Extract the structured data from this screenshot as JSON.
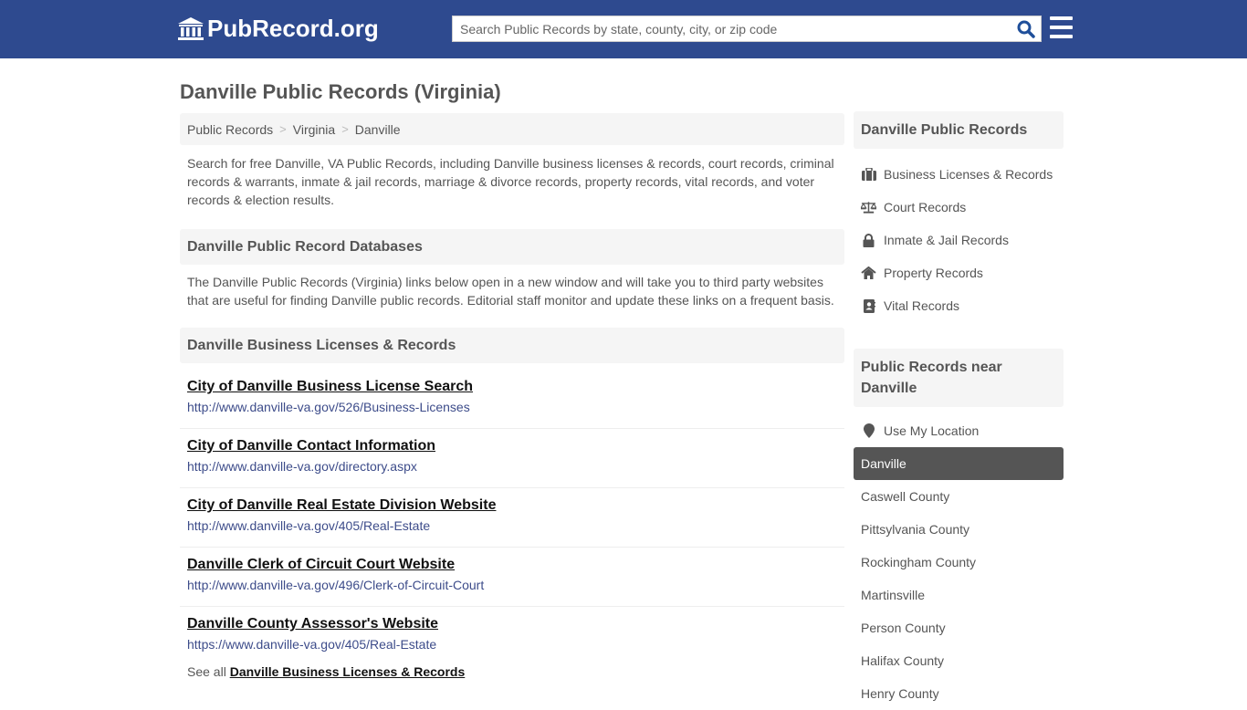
{
  "header": {
    "logo_text": "PubRecord.org",
    "search_placeholder": "Search Public Records by state, county, city, or zip code",
    "search_value": ""
  },
  "page_title": "Danville Public Records (Virginia)",
  "breadcrumb": [
    {
      "label": "Public Records"
    },
    {
      "label": "Virginia"
    },
    {
      "label": "Danville"
    }
  ],
  "intro": "Search for free Danville, VA Public Records, including Danville business licenses & records, court records, criminal records & warrants, inmate & jail records, marriage & divorce records, property records, vital records, and voter records & election results.",
  "databases": {
    "heading": "Danville Public Record Databases",
    "text": "The Danville Public Records (Virginia) links below open in a new window and will take you to third party websites that are useful for finding Danville public records. Editorial staff monitor and update these links on a frequent basis."
  },
  "business": {
    "heading": "Danville Business Licenses & Records",
    "links": [
      {
        "title": "City of Danville Business License Search",
        "url": "http://www.danville-va.gov/526/Business-Licenses"
      },
      {
        "title": "City of Danville Contact Information",
        "url": "http://www.danville-va.gov/directory.aspx"
      },
      {
        "title": "City of Danville Real Estate Division Website",
        "url": "http://www.danville-va.gov/405/Real-Estate"
      },
      {
        "title": "Danville Clerk of Circuit Court Website",
        "url": "http://www.danville-va.gov/496/Clerk-of-Circuit-Court"
      },
      {
        "title": "Danville County Assessor's Website",
        "url": "https://www.danville-va.gov/405/Real-Estate"
      }
    ],
    "see_all_prefix": "See all",
    "see_all_link": "Danville Business Licenses & Records"
  },
  "sidebar": {
    "records_heading": "Danville Public Records",
    "records": [
      {
        "label": "Business Licenses & Records",
        "icon": "briefcase-icon"
      },
      {
        "label": "Court Records",
        "icon": "scale-icon"
      },
      {
        "label": "Inmate & Jail Records",
        "icon": "lock-icon"
      },
      {
        "label": "Property Records",
        "icon": "home-icon"
      },
      {
        "label": "Vital Records",
        "icon": "address-book-icon"
      }
    ],
    "near_heading": "Public Records near Danville",
    "use_location": "Use My Location",
    "near": [
      {
        "label": "Danville",
        "active": true
      },
      {
        "label": "Caswell County"
      },
      {
        "label": "Pittsylvania County"
      },
      {
        "label": "Rockingham County"
      },
      {
        "label": "Martinsville"
      },
      {
        "label": "Person County"
      },
      {
        "label": "Halifax County"
      },
      {
        "label": "Henry County"
      }
    ]
  },
  "colors": {
    "header_bg": "#2e4a8f",
    "search_icon": "#1f4f9a",
    "link_url": "#3d4c8a",
    "active_item_bg": "#555555"
  }
}
